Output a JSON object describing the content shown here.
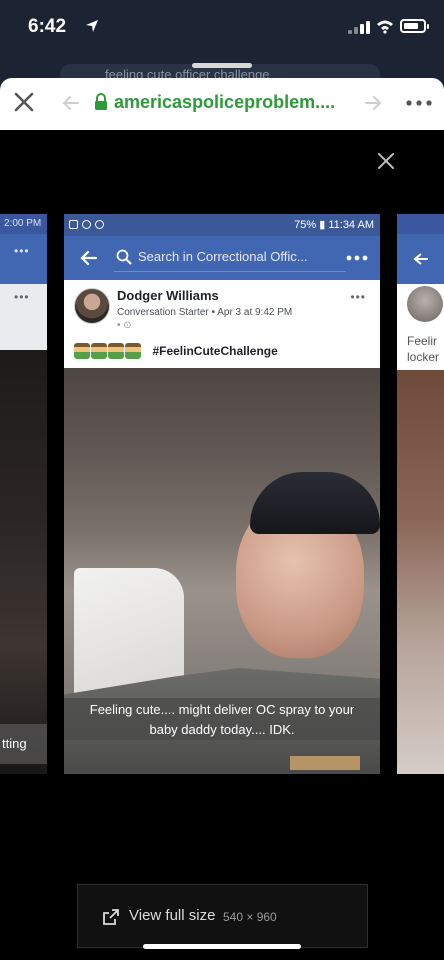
{
  "status_bar": {
    "time": "6:42",
    "battery_level": 0.75
  },
  "behind_search": {
    "query": "feeling cute officer challenge"
  },
  "browser": {
    "url": "americaspoliceproblem....",
    "accent_color": "#2e9a3a"
  },
  "viewer": {
    "side_left": {
      "time": "2:00 PM",
      "caption": "tting"
    },
    "side_right": {
      "text_line1": "Feelir",
      "text_line2": "locker"
    },
    "fb": {
      "status_right": "75% ▮ 11:34 AM",
      "search_placeholder": "Search in Correctional Offic...",
      "author": "Dodger Williams",
      "meta": "Conversation Starter • Apr 3 at 9:42 PM",
      "meta2": "• ⊙",
      "hashtag": "#FeelinCuteChallenge",
      "emoji_count": 4,
      "caption_line1": "Feeling cute.... might deliver OC spray to your",
      "caption_line2": "baby daddy today....  IDK.",
      "brand_color": "#4267b2"
    },
    "full_size": {
      "label": "View full size",
      "dims": "540 × 960"
    }
  }
}
